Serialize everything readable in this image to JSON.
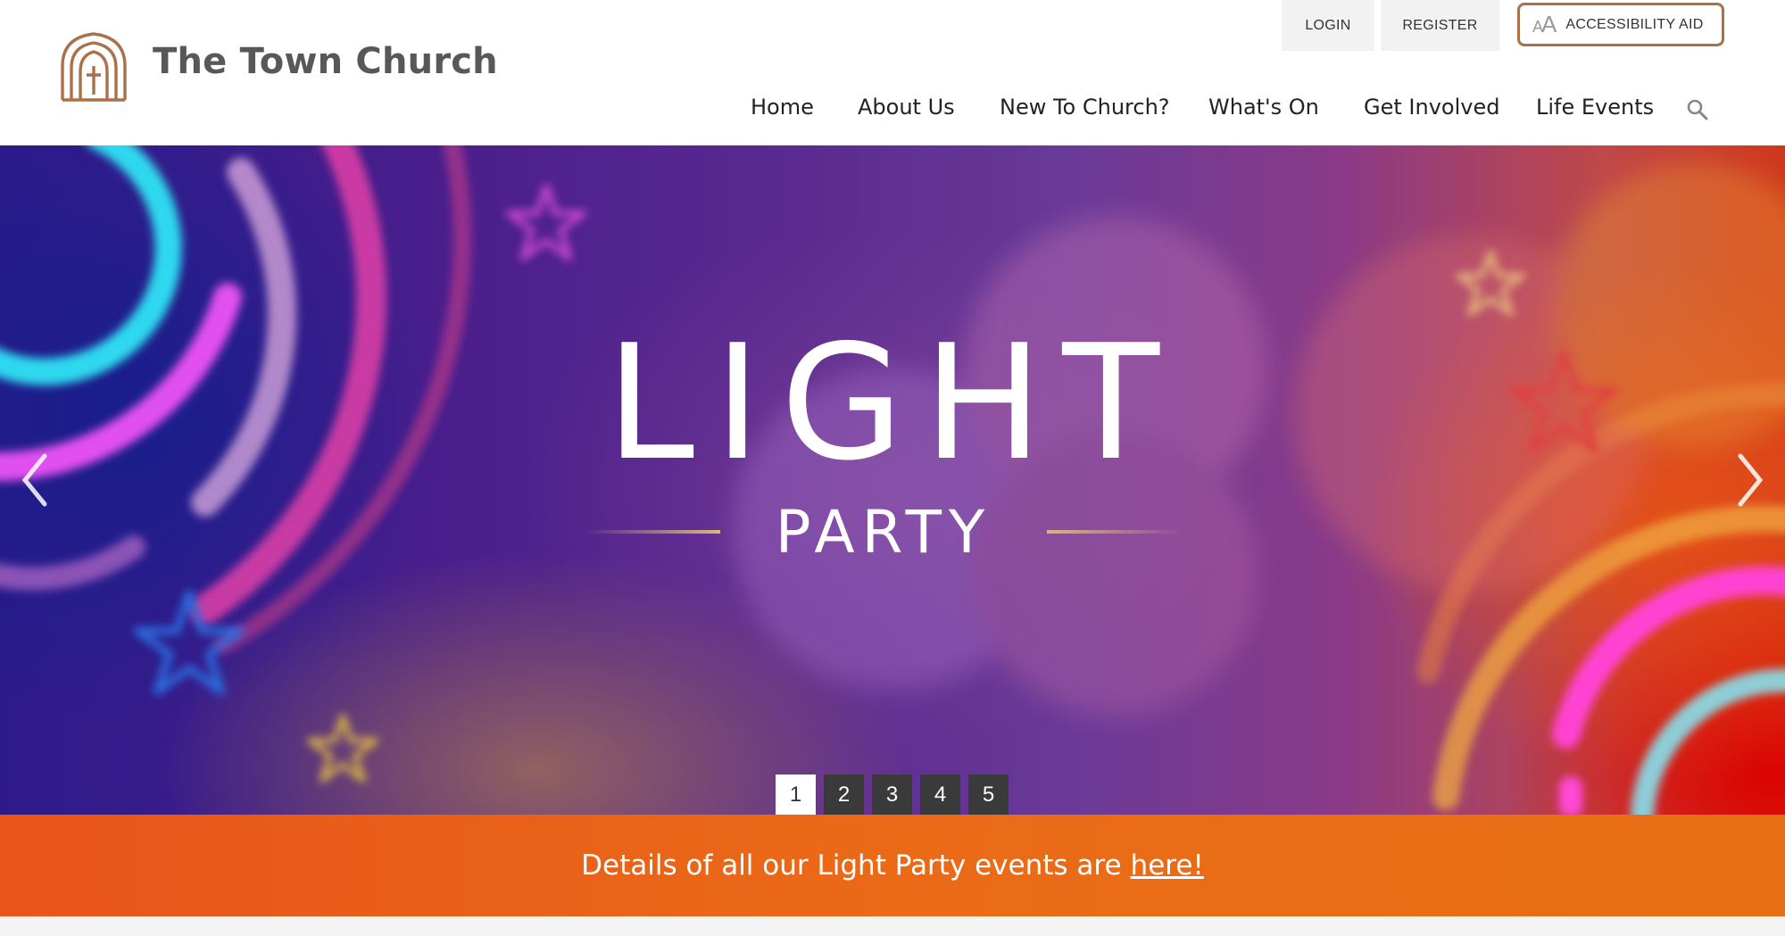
{
  "header": {
    "site_title": "The Town Church",
    "logo_icon": "church-arch-logo-icon",
    "brand_color": "#a9714a",
    "utility": {
      "login": "LOGIN",
      "register": "REGISTER",
      "accessibility": "ACCESSIBILITY AID",
      "accessibility_icon": "text-size-icon"
    },
    "nav": [
      {
        "label": "Home"
      },
      {
        "label": "About Us"
      },
      {
        "label": "New To Church?"
      },
      {
        "label": "What's On"
      },
      {
        "label": "Get Involved"
      },
      {
        "label": "Life Events"
      }
    ],
    "search_icon": "search-icon"
  },
  "hero": {
    "title": "LIGHT",
    "subtitle": "PARTY",
    "prev_icon": "chevron-left-icon",
    "next_icon": "chevron-right-icon",
    "pages": [
      "1",
      "2",
      "3",
      "4",
      "5"
    ],
    "active_page": "1"
  },
  "banner": {
    "text": "Details of all our Light Party events are",
    "link": "here!",
    "color": "#e8601a"
  }
}
